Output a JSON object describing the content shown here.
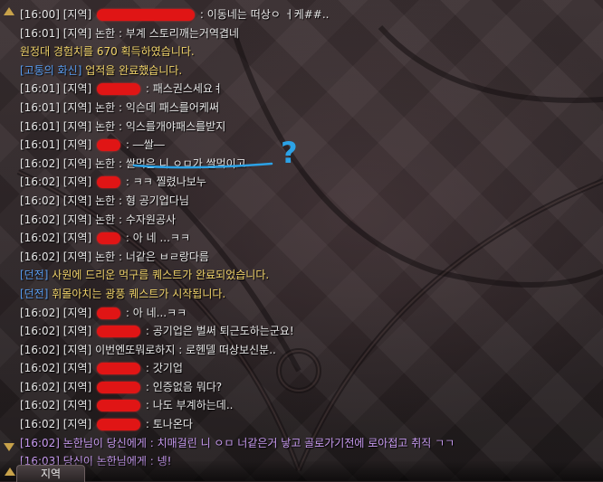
{
  "chat": {
    "lines": [
      {
        "type": "normal",
        "ts": "[16:00]",
        "ch": "[지역]",
        "redact": "long",
        "speaker": "",
        "msg": ": 이동네는 떠상ㅇ ㅓ케##.."
      },
      {
        "type": "normal",
        "ts": "[16:01]",
        "ch": "[지역]",
        "redact": "",
        "speaker": "논한",
        "msg": ": 부계 스토리깨는거역겹네"
      },
      {
        "type": "system",
        "text": "원정대 경험치를 670 획득하였습니다."
      },
      {
        "type": "system",
        "tag": "[고통의 화신]",
        "text": "업적을 완료했습니다."
      },
      {
        "type": "normal",
        "ts": "[16:01]",
        "ch": "[지역]",
        "redact": "mid",
        "speaker": "",
        "msg": ": 패스권스세요ㅕ"
      },
      {
        "type": "normal",
        "ts": "[16:01]",
        "ch": "[지역]",
        "redact": "",
        "speaker": "논한",
        "msg": ": 익슨데 패스를어케써"
      },
      {
        "type": "normal",
        "ts": "[16:01]",
        "ch": "[지역]",
        "redact": "",
        "speaker": "논한",
        "msg": ": 익스를개야패스를받지"
      },
      {
        "type": "normal",
        "ts": "[16:01]",
        "ch": "[지역]",
        "redact": "short",
        "speaker": "",
        "msg": ": ―쌀―"
      },
      {
        "type": "normal",
        "ts": "[16:02]",
        "ch": "[지역]",
        "redact": "",
        "speaker": "논한",
        "msg": ": 쌀먹은 니 ㅇㅁ가 쌀먹이고",
        "underline": true
      },
      {
        "type": "normal",
        "ts": "[16:02]",
        "ch": "[지역]",
        "redact": "short",
        "speaker": "",
        "msg": ": ㅋㅋ 찔렸나보누"
      },
      {
        "type": "normal",
        "ts": "[16:02]",
        "ch": "[지역]",
        "redact": "",
        "speaker": "논한",
        "msg": ": 형 공기업다님"
      },
      {
        "type": "normal",
        "ts": "[16:02]",
        "ch": "[지역]",
        "redact": "",
        "speaker": "논한",
        "msg": ": 수자원공사"
      },
      {
        "type": "normal",
        "ts": "[16:02]",
        "ch": "[지역]",
        "redact": "short",
        "speaker": "",
        "msg": ": 아 네 ...ㅋㅋ"
      },
      {
        "type": "normal",
        "ts": "[16:02]",
        "ch": "[지역]",
        "redact": "",
        "speaker": "논한",
        "msg": ": 너같은 ㅂㄹ랑다름"
      },
      {
        "type": "quest",
        "tag": "[던전]",
        "quest": "사원에 드리운 먹구름",
        "text": "퀘스트가 완료되었습니다."
      },
      {
        "type": "quest",
        "tag": "[던전]",
        "quest": "휘몰아치는 광풍",
        "text": "퀘스트가 시작됩니다."
      },
      {
        "type": "normal",
        "ts": "[16:02]",
        "ch": "[지역]",
        "redact": "short",
        "speaker": "",
        "msg": ": 아 네...ㅋㅋ"
      },
      {
        "type": "normal",
        "ts": "[16:02]",
        "ch": "[지역]",
        "redact": "mid",
        "speaker": "",
        "msg": ": 공기업은 벌써 퇴근도하는군요!"
      },
      {
        "type": "normal",
        "ts": "[16:02]",
        "ch": "[지역]",
        "redact": "",
        "speaker": "",
        "msg": "이번엔또뭐로하지 : 로헨델 떠상보신분.."
      },
      {
        "type": "normal",
        "ts": "[16:02]",
        "ch": "[지역]",
        "redact": "mid",
        "speaker": "",
        "msg": ": 갓기업"
      },
      {
        "type": "normal",
        "ts": "[16:02]",
        "ch": "[지역]",
        "redact": "mid",
        "speaker": "",
        "msg": ": 인증없음 뭐다?"
      },
      {
        "type": "normal",
        "ts": "[16:02]",
        "ch": "[지역]",
        "redact": "mid",
        "speaker": "",
        "msg": ": 나도 부계하는데.."
      },
      {
        "type": "normal",
        "ts": "[16:02]",
        "ch": "[지역]",
        "redact": "mid",
        "speaker": "",
        "msg": ": 토나온다"
      },
      {
        "type": "whisper",
        "ts": "[16:02]",
        "msg": "논한님이 당신에게 : 치매걸린 니 ㅇㅁ 너같은거 낳고 골로가기전에 로아접고 취직 ㄱㄱ"
      },
      {
        "type": "whisper",
        "ts": "[16:03]",
        "msg": "당신이 논한님에게 : 넹!"
      }
    ]
  },
  "tab_bar": {
    "active_tab": "지역"
  },
  "annotation": {
    "mark": "?"
  },
  "colors": {
    "system": "#f0d36a",
    "tag": "#5a9df0",
    "whisper": "#c79af0",
    "annot": "#2ca2e6",
    "redact": "#e01515"
  }
}
